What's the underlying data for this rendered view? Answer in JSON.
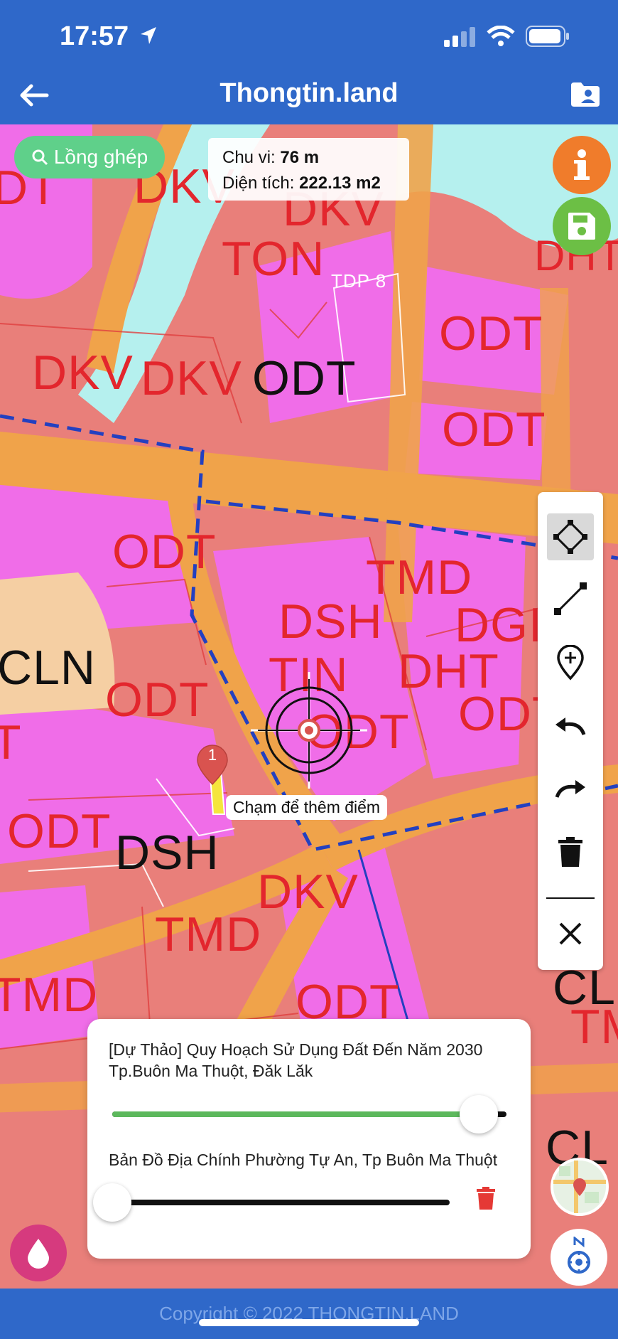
{
  "status_bar": {
    "time": "17:57"
  },
  "header": {
    "title": "Thongtin.land",
    "back_icon": "arrow-left-icon",
    "folder_icon": "folder-user-icon"
  },
  "map": {
    "merge_button_label": "Lồng ghép",
    "measure": {
      "perimeter_label": "Chu vi:",
      "perimeter_value": "76 m",
      "area_label": "Diện tích:",
      "area_value": "222.13 m2"
    },
    "labels": [
      "DKV",
      "DKV",
      "TON",
      "DKV",
      "DKV",
      "ODT",
      "ODT",
      "ODT",
      "ODT",
      "ODT",
      "TMD",
      "DSH",
      "DGI",
      "TIN",
      "DHT",
      "CLN",
      "ODT",
      "ODT",
      "ODT",
      "ODT",
      "DSH",
      "DKV",
      "TMD",
      "TMD",
      "ODT",
      "CL",
      "TM",
      "CL",
      "DHT",
      "DT",
      "T",
      "TDP 8"
    ],
    "marker_number": "1",
    "tap_hint": "Chạm để thêm điểm"
  },
  "toolbar": {
    "tools": [
      {
        "name": "polygon-tool",
        "icon": "polygon-icon",
        "active": true
      },
      {
        "name": "line-tool",
        "icon": "line-icon",
        "active": false
      },
      {
        "name": "add-point-tool",
        "icon": "map-pin-plus-icon",
        "active": false
      },
      {
        "name": "undo-tool",
        "icon": "undo-icon",
        "active": false
      },
      {
        "name": "redo-tool",
        "icon": "redo-icon",
        "active": false
      },
      {
        "name": "delete-tool",
        "icon": "trash-icon",
        "active": false
      },
      {
        "name": "close-tool",
        "icon": "close-icon",
        "active": false
      }
    ]
  },
  "layers_panel": {
    "layer1": {
      "name": "[Dự Thảo] Quy Hoạch Sử Dụng Đất Đến Năm 2030 Tp.Buôn Ma Thuột, Đăk Lăk",
      "opacity": 0.93
    },
    "layer2": {
      "name": "Bản Đồ Địa Chính Phường Tự An, Tp Buôn Ma Thuột",
      "opacity": 0.0
    }
  },
  "footer": {
    "copyright": "Copyright © 2022 THONGTIN.LAND"
  },
  "colors": {
    "header": "#2f68c9",
    "info": "#f07c2b",
    "save": "#6cbf45",
    "merge": "#5fd08a",
    "slider_active": "#5cb85c",
    "delete": "#e53935"
  }
}
